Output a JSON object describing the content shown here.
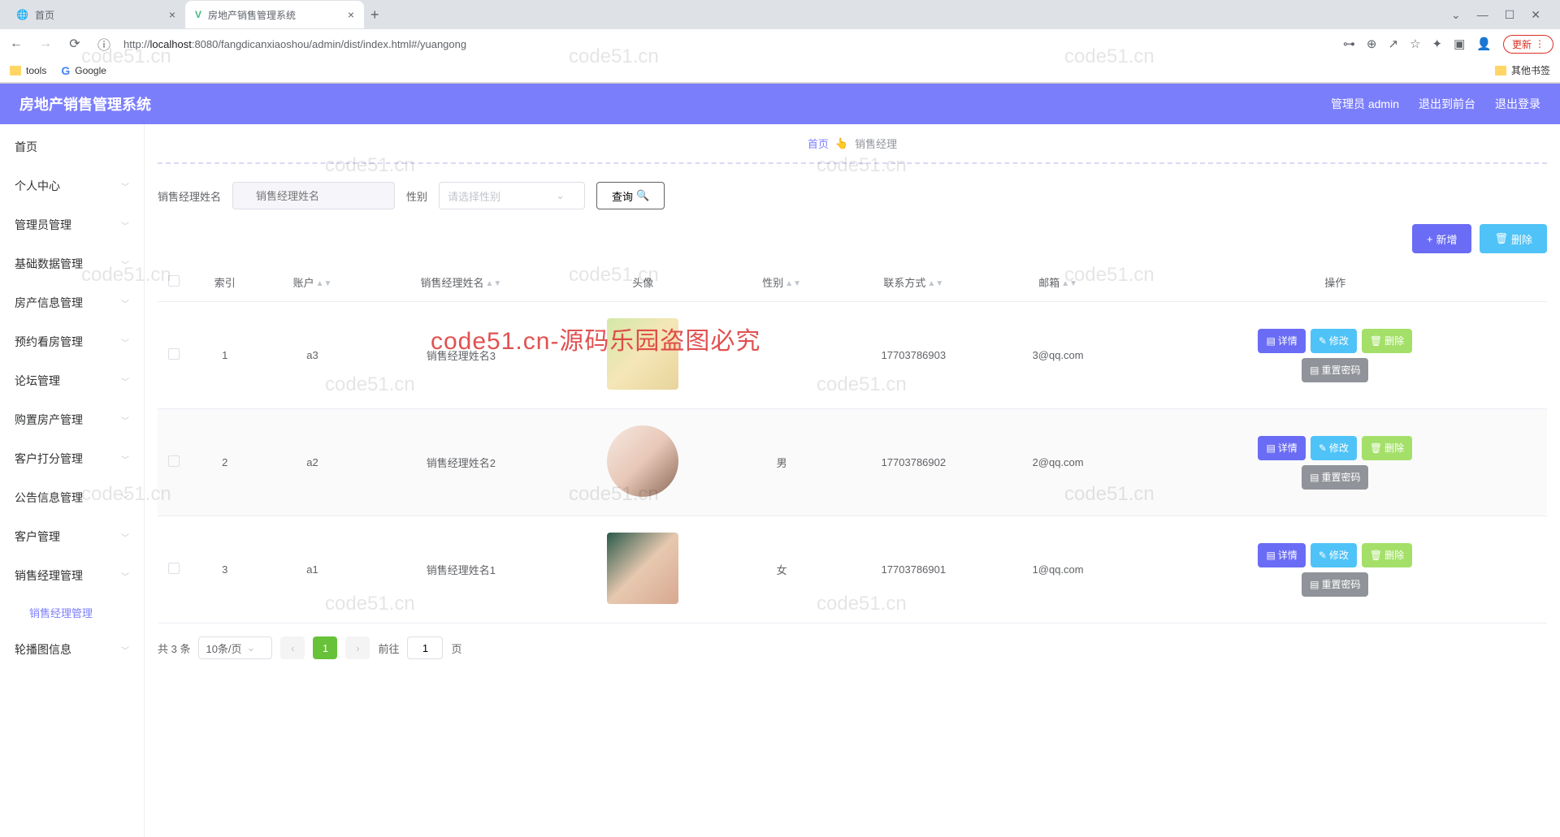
{
  "browser": {
    "tabs": [
      {
        "title": "首页",
        "active": false
      },
      {
        "title": "房地产销售管理系统",
        "active": true
      }
    ],
    "url_prefix": "http://",
    "url_host": "localhost",
    "url_port": ":8080",
    "url_path": "/fangdicanxiaoshou/admin/dist/index.html#/yuangong",
    "update_label": "更新",
    "bookmarks": {
      "tools": "tools",
      "google": "Google",
      "other": "其他书签"
    }
  },
  "header": {
    "app_title": "房地产销售管理系统",
    "user_label": "管理员 admin",
    "logout_front": "退出到前台",
    "logout": "退出登录"
  },
  "sidebar": {
    "items": [
      "首页",
      "个人中心",
      "管理员管理",
      "基础数据管理",
      "房产信息管理",
      "预约看房管理",
      "论坛管理",
      "购置房产管理",
      "客户打分管理",
      "公告信息管理",
      "客户管理",
      "销售经理管理"
    ],
    "submenu_active": "销售经理管理",
    "last_item": "轮播图信息"
  },
  "breadcrumb": {
    "home": "首页",
    "current": "销售经理"
  },
  "search": {
    "name_label": "销售经理姓名",
    "name_placeholder": "销售经理姓名",
    "gender_label": "性别",
    "gender_placeholder": "请选择性别",
    "query_btn": "查询"
  },
  "toolbar": {
    "add_label": "新增",
    "delete_label": "删除"
  },
  "table": {
    "headers": {
      "index": "索引",
      "account": "账户",
      "name": "销售经理姓名",
      "avatar": "头像",
      "gender": "性别",
      "phone": "联系方式",
      "email": "邮箱",
      "actions": "操作"
    },
    "action_labels": {
      "detail": "详情",
      "edit": "修改",
      "delete": "删除",
      "reset_pwd": "重置密码"
    },
    "rows": [
      {
        "index": "1",
        "account": "a3",
        "name": "销售经理姓名3",
        "gender": "",
        "phone": "17703786903",
        "email": "3@qq.com",
        "avatar_round": false
      },
      {
        "index": "2",
        "account": "a2",
        "name": "销售经理姓名2",
        "gender": "男",
        "phone": "17703786902",
        "email": "2@qq.com",
        "avatar_round": true
      },
      {
        "index": "3",
        "account": "a1",
        "name": "销售经理姓名1",
        "gender": "女",
        "phone": "17703786901",
        "email": "1@qq.com",
        "avatar_round": false
      }
    ]
  },
  "pagination": {
    "total_label": "共 3 条",
    "page_size": "10条/页",
    "current_page": "1",
    "goto_label": "前往",
    "goto_value": "1",
    "page_suffix": "页"
  },
  "watermark": {
    "text": "code51.cn",
    "red": "code51.cn-源码乐园盗图必究"
  }
}
